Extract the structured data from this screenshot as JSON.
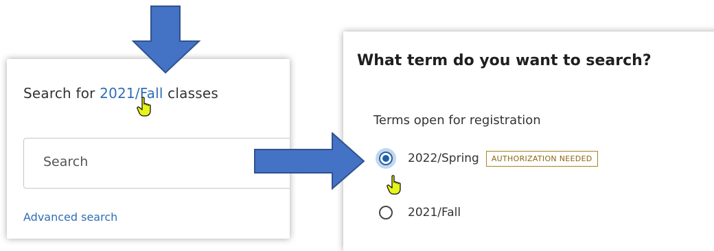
{
  "search_panel": {
    "title_prefix": "Search for ",
    "term_link": "2021/Fall",
    "title_suffix": " classes",
    "search_placeholder": "Search",
    "advanced_link": "Advanced search"
  },
  "term_panel": {
    "heading": "What term do you want to search?",
    "subheading": "Terms open for registration",
    "options": [
      {
        "label": "2022/Spring",
        "badge": "AUTHORIZATION NEEDED",
        "selected": true
      },
      {
        "label": "2021/Fall",
        "badge": "",
        "selected": false
      }
    ]
  },
  "colors": {
    "link": "#2f6db4",
    "arrow_fill": "#4472c4",
    "arrow_stroke": "#2f528f",
    "radio_selected": "#1f5fa8",
    "badge_border": "#a8811c",
    "cursor_highlight": "#e6f51a"
  },
  "icons": {
    "arrow_down": "down-arrow-icon",
    "arrow_right": "right-arrow-icon",
    "hand_cursor": "hand-pointer-icon"
  }
}
